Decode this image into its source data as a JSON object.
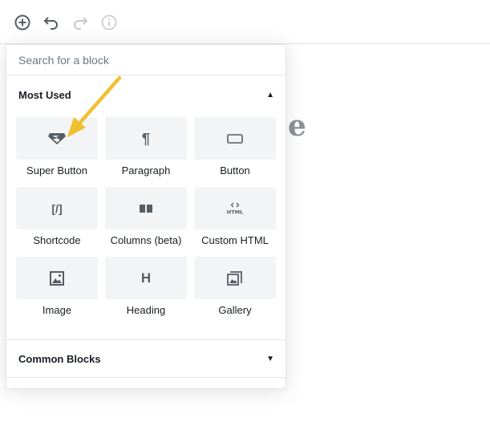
{
  "toolbar": {
    "icons": [
      "add-block-icon",
      "undo-icon",
      "redo-icon",
      "info-icon"
    ]
  },
  "background": {
    "title_fragment": "e"
  },
  "inserter": {
    "search_placeholder": "Search for a block",
    "most_used": {
      "title": "Most Used",
      "state": "expanded",
      "blocks": [
        {
          "label": "Super Button",
          "icon": "superman-icon"
        },
        {
          "label": "Paragraph",
          "icon": "paragraph-icon"
        },
        {
          "label": "Button",
          "icon": "button-icon"
        },
        {
          "label": "Shortcode",
          "icon": "shortcode-icon"
        },
        {
          "label": "Columns (beta)",
          "icon": "columns-icon"
        },
        {
          "label": "Custom HTML",
          "icon": "html-icon"
        },
        {
          "label": "Image",
          "icon": "image-icon"
        },
        {
          "label": "Heading",
          "icon": "heading-icon"
        },
        {
          "label": "Gallery",
          "icon": "gallery-icon"
        }
      ]
    },
    "common_blocks": {
      "title": "Common Blocks",
      "state": "collapsed"
    }
  },
  "colors": {
    "accent_arrow": "#f0c030",
    "tile_bg": "#f3f4f5",
    "border": "#e2e4e7"
  }
}
